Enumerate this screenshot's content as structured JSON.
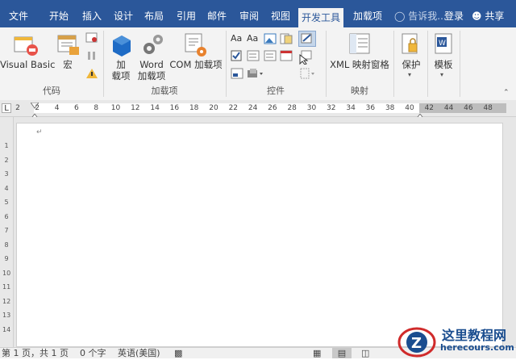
{
  "tabs": [
    "文件",
    "开始",
    "插入",
    "设计",
    "布局",
    "引用",
    "邮件",
    "审阅",
    "视图",
    "开发工具",
    "加载项"
  ],
  "active_tab": "开发工具",
  "tell_me": "告诉我...",
  "login": "登录",
  "share": "共享",
  "groups": {
    "code": {
      "label": "代码",
      "visual_basic": "Visual Basic",
      "macro": "宏"
    },
    "addins": {
      "label": "加载项",
      "addin_line1": "加",
      "addin_line2": "载项",
      "word_line1": "Word",
      "word_line2": "加载项",
      "com": "COM 加载项"
    },
    "controls": {
      "label": "控件"
    },
    "mapping": {
      "label": "映射",
      "xml_pane": "XML 映射窗格"
    },
    "protect": {
      "label": "保护"
    },
    "templates": {
      "label": "模板"
    }
  },
  "ruler_ticks": [
    "2",
    "2",
    "4",
    "6",
    "8",
    "10",
    "12",
    "14",
    "16",
    "18",
    "20",
    "22",
    "24",
    "26",
    "28",
    "30",
    "32",
    "34",
    "36",
    "38",
    "40",
    "42",
    "44",
    "46",
    "48"
  ],
  "vruler_ticks": [
    "1",
    "2",
    "3",
    "4",
    "5",
    "6",
    "7",
    "8",
    "9",
    "10",
    "11",
    "12",
    "13",
    "14"
  ],
  "status": {
    "page": "第 1 页，共 1 页",
    "words": "0 个字",
    "language": "英语(美国)"
  },
  "watermark": {
    "title": "这里教程网",
    "url": "herecours.com"
  },
  "colors": {
    "ribbon_blue": "#2b579a",
    "ribbon_bg": "#f3f3f3"
  }
}
